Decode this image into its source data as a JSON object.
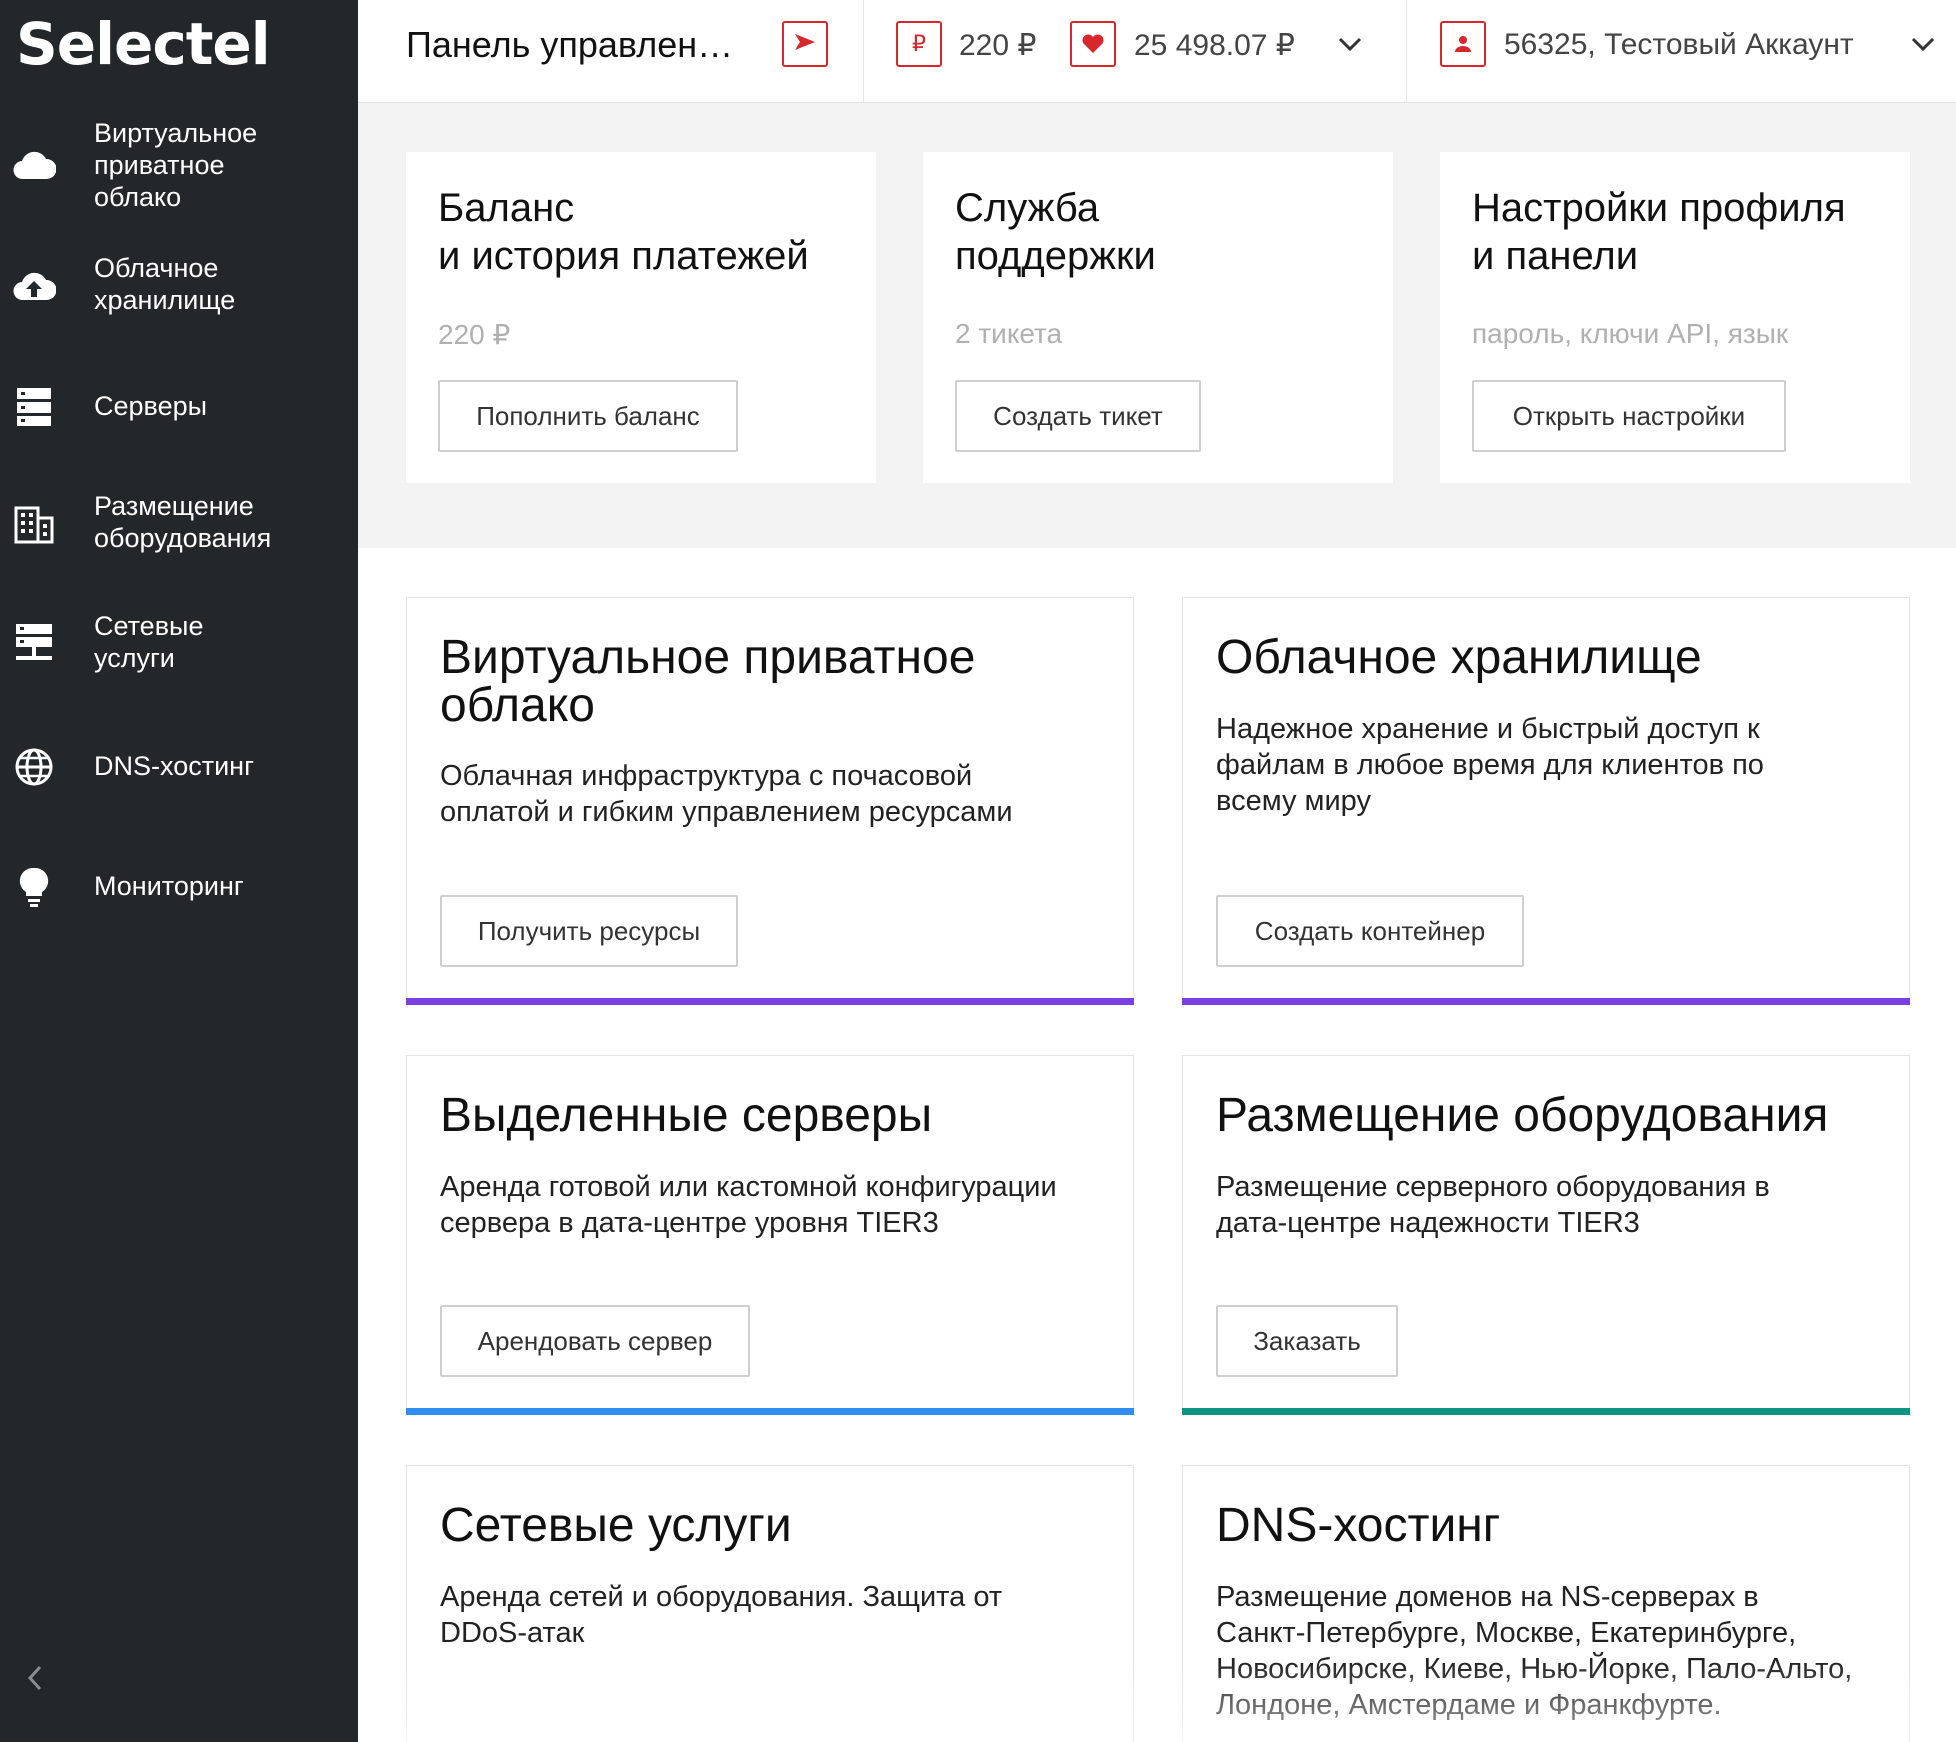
{
  "brand": {
    "logo": "Selectel"
  },
  "sidebar": {
    "items": [
      {
        "label": "Виртуальное\nприватное\nоблако",
        "icon": "cloud-icon"
      },
      {
        "label": "Облачное\nхранилище",
        "icon": "cloud-upload-icon"
      },
      {
        "label": "Серверы",
        "icon": "servers-icon"
      },
      {
        "label": "Размещение\nоборудования",
        "icon": "building-icon"
      },
      {
        "label": "Сетевые\nуслуги",
        "icon": "network-icon"
      },
      {
        "label": "DNS-хостинг",
        "icon": "globe-icon"
      },
      {
        "label": "Мониторинг",
        "icon": "bulb-icon"
      }
    ],
    "collapse_icon": "chevron-left-icon"
  },
  "header": {
    "title": "Панель управления",
    "balance_currency_symbol": "₽",
    "balance": "220 ₽",
    "bonus": "25 498.07 ₽",
    "account": "56325,  Тестовый Аккаунт",
    "accent_color": "#d8262d"
  },
  "top_cards": [
    {
      "title": "Баланс\nи история платежей",
      "sub": "220 ₽",
      "button": "Пополнить баланс"
    },
    {
      "title": "Служба\nподдержки",
      "sub": "2 тикета",
      "button": "Создать тикет"
    },
    {
      "title": "Настройки профиля\nи панели",
      "sub": "пароль, ключи API, язык",
      "button": "Открыть настройки"
    }
  ],
  "services": [
    {
      "title": "Виртуальное приватное\nоблако",
      "desc": "Облачная инфраструктура с почасовой\nоплатой и гибким управлением ресурсами",
      "button": "Получить ресурсы",
      "color": "#7b3fe4"
    },
    {
      "title": "Облачное хранилище",
      "desc": "Надежное хранение и быстрый доступ к\nфайлам в любое время для клиентов по\nвсему миру",
      "button": "Создать контейнер",
      "color": "#7b3fe4"
    },
    {
      "title": "Выделенные серверы",
      "desc": "Аренда готовой или кастомной конфигурации\nсервера в дата-центре уровня TIER3",
      "button": "Арендовать сервер",
      "color": "#2f8cf0"
    },
    {
      "title": "Размещение оборудования",
      "desc": "Размещение серверного оборудования в\nдата-центре надежности TIER3",
      "button": "Заказать",
      "color": "#0e9480"
    },
    {
      "title": "Сетевые услуги",
      "desc": "Аренда сетей и оборудования. Защита от\nDDoS-атак",
      "button": "",
      "color": ""
    },
    {
      "title": "DNS-хостинг",
      "desc": "Размещение доменов на NS-серверах в\nСанкт-Петербурге, Москве, Екатеринбурге,\nНовосибирске, Киеве, Нью-Йорке, Пало-Альто,\nЛондоне, Амстердаме и Франкфурте.",
      "button": "",
      "color": ""
    }
  ]
}
